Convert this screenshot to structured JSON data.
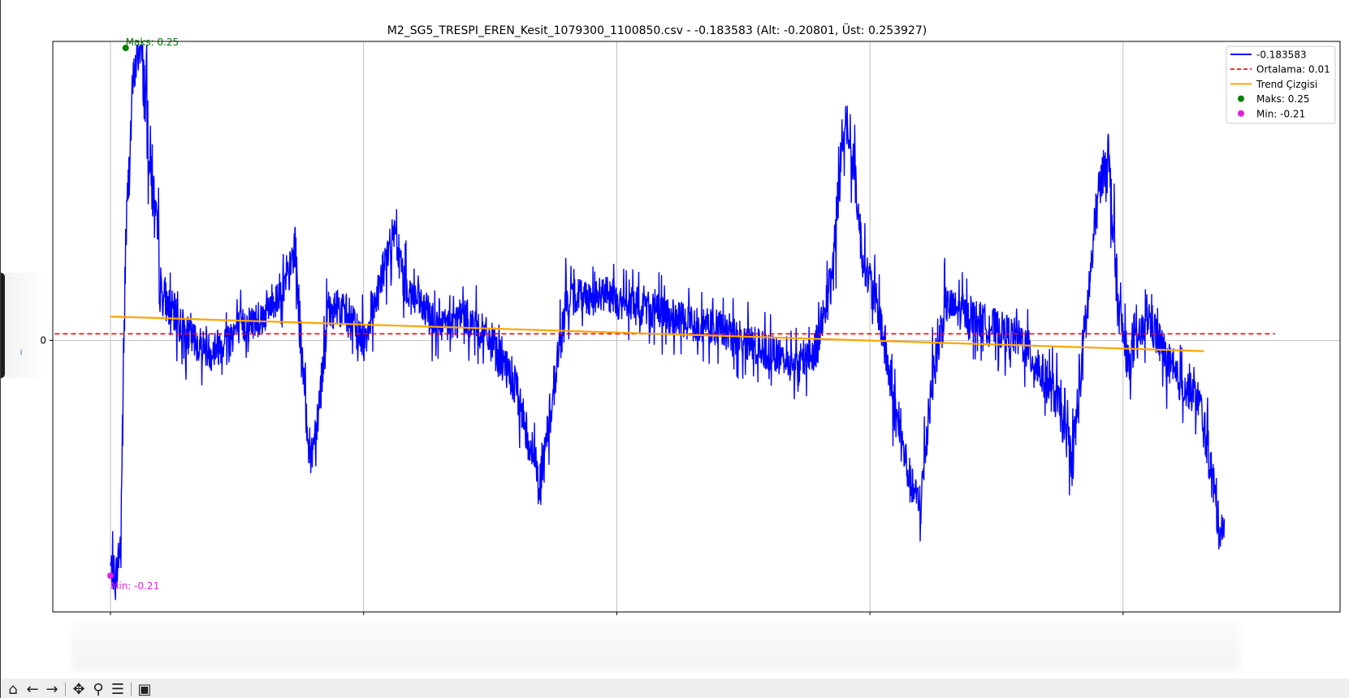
{
  "title": "M2_SG5_TRESPI_EREN_Kesit_1079300_1100850.csv - -0.183583 (Alt: -0.20801, Üst: 0.253927)",
  "colors": {
    "series": "#0000ff",
    "mean": "#ff0000",
    "trend": "#ffa500",
    "max_marker": "#008000",
    "min_marker": "#e020e0",
    "grid": "#b0b0b0"
  },
  "chart_data": {
    "type": "line",
    "title": "M2_SG5_TRESPI_EREN_Kesit_1079300_1100850.csv - -0.183583 (Alt: -0.20801, Üst: 0.253927)",
    "xlabel": "",
    "ylabel": "",
    "xlim": [
      -0.22,
      4.6
    ],
    "ylim": [
      -0.228,
      0.251
    ],
    "grid": true,
    "yticks": [
      0
    ],
    "ytick_labels": [
      "0"
    ],
    "legend_position": "upper right",
    "series": [
      {
        "name": "-0.183583",
        "style": "solid",
        "color": "#0000ff",
        "x": [
          0,
          0.02,
          0.04,
          0.06,
          0.09,
          0.12,
          0.2,
          0.3,
          0.4,
          0.5,
          0.6,
          0.7,
          0.73,
          0.76,
          0.79,
          0.82,
          0.86,
          0.9,
          1.0,
          1.08,
          1.12,
          1.16,
          1.22,
          1.3,
          1.4,
          1.5,
          1.6,
          1.65,
          1.7,
          1.75,
          1.8,
          1.86,
          1.9,
          1.96,
          2.02,
          2.1,
          2.2,
          2.4,
          2.6,
          2.7,
          2.78,
          2.85,
          2.9,
          2.94,
          2.97,
          3.0,
          3.04,
          3.1,
          3.16,
          3.2,
          3.24,
          3.3,
          3.4,
          3.6,
          3.74,
          3.8,
          3.86,
          3.9,
          3.94,
          3.98,
          4.02,
          4.06,
          4.1,
          4.2,
          4.3,
          4.35,
          4.38,
          4.4
        ],
        "y": [
          -0.19,
          -0.2,
          -0.17,
          0.08,
          0.22,
          0.25,
          0.04,
          0.005,
          -0.01,
          0.01,
          0.02,
          0.05,
          0.08,
          -0.03,
          -0.1,
          -0.06,
          0.02,
          0.03,
          0.0,
          0.06,
          0.09,
          0.05,
          0.03,
          0.01,
          0.02,
          0.0,
          -0.04,
          -0.08,
          -0.12,
          -0.04,
          0.03,
          0.04,
          0.035,
          0.04,
          0.03,
          0.03,
          0.02,
          0.01,
          -0.01,
          -0.02,
          -0.01,
          0.05,
          0.19,
          0.14,
          0.07,
          0.05,
          0.02,
          -0.06,
          -0.12,
          -0.14,
          -0.04,
          0.03,
          0.02,
          0.0,
          -0.05,
          -0.1,
          0.03,
          0.12,
          0.16,
          0.03,
          -0.02,
          0.0,
          0.02,
          -0.03,
          -0.05,
          -0.11,
          -0.16,
          -0.15
        ]
      },
      {
        "name": "Ortalama: 0.01",
        "style": "dashed",
        "color": "#ff0000",
        "x": [
          -0.22,
          4.6
        ],
        "y": [
          0.0055,
          0.0055
        ]
      },
      {
        "name": "Trend Çizgisi",
        "style": "solid",
        "color": "#ffa500",
        "x": [
          0,
          4.32
        ],
        "y": [
          0.02,
          -0.009
        ]
      }
    ],
    "points": [
      {
        "name": "Maks: 0.25",
        "label": "Maks: 0.25",
        "color": "#008000",
        "x": 0.06,
        "y": 0.2455
      },
      {
        "name": "Min: -0.21",
        "label": "Min: -0.21",
        "color": "#e020e0",
        "x": 0.0,
        "y": -0.1975
      }
    ]
  },
  "toolbar": {
    "buttons": [
      {
        "name": "home-icon",
        "glyph": "⌂"
      },
      {
        "name": "back-icon",
        "glyph": "←"
      },
      {
        "name": "forward-icon",
        "glyph": "→"
      },
      {
        "name": "pan-icon",
        "glyph": "✥"
      },
      {
        "name": "zoom-icon",
        "glyph": "⚲"
      },
      {
        "name": "configure-subplots-icon",
        "glyph": "☰"
      },
      {
        "name": "save-icon",
        "glyph": "▣"
      }
    ]
  }
}
